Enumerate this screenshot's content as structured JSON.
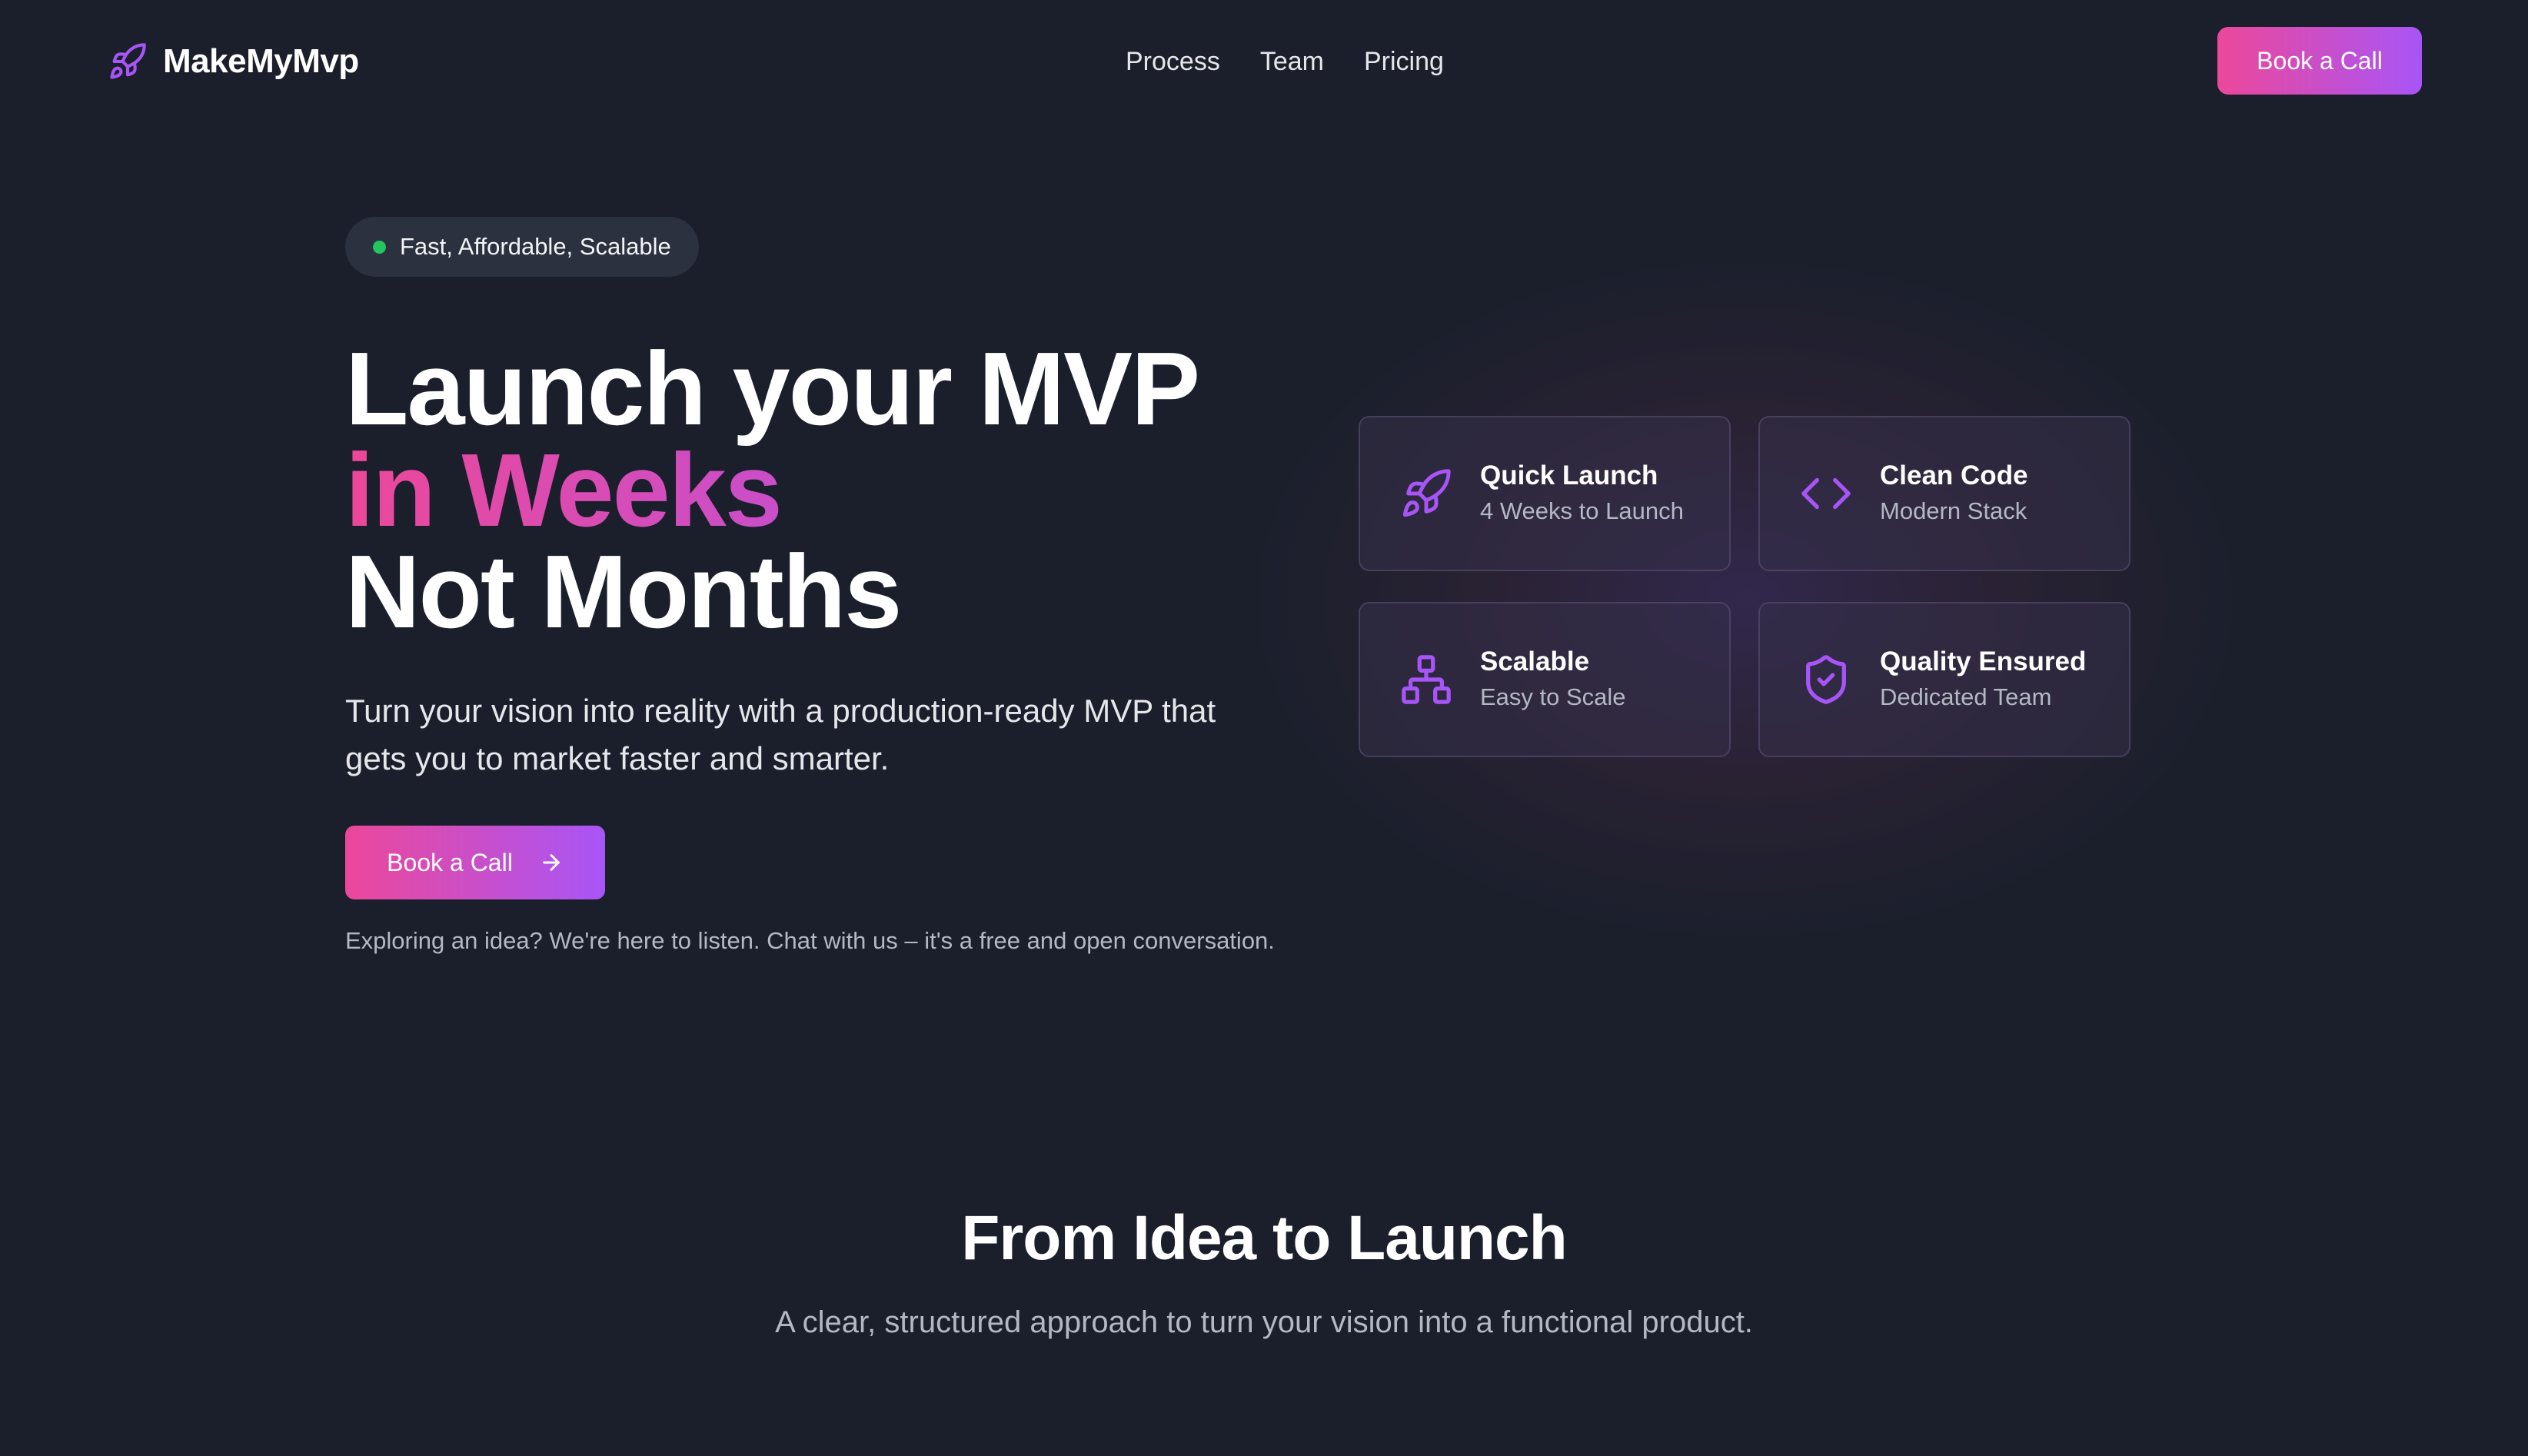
{
  "brand": {
    "name": "MakeMyMvp",
    "icon": "rocket-icon"
  },
  "nav": {
    "links": [
      "Process",
      "Team",
      "Pricing"
    ],
    "cta_label": "Book a Call"
  },
  "hero": {
    "badge": "Fast, Affordable, Scalable",
    "title_line1": "Launch your MVP",
    "title_line2": "in Weeks",
    "title_line3": "Not Months",
    "subtitle": "Turn your vision into reality with a production-ready MVP that gets you to market faster and smarter.",
    "cta_label": "Book a Call",
    "note": "Exploring an idea? We're here to listen. Chat with us – it's a free and open conversation."
  },
  "features": [
    {
      "title": "Quick Launch",
      "subtitle": "4 Weeks to Launch",
      "icon": "rocket-icon"
    },
    {
      "title": "Clean Code",
      "subtitle": "Modern Stack",
      "icon": "code-icon"
    },
    {
      "title": "Scalable",
      "subtitle": "Easy to Scale",
      "icon": "network-icon"
    },
    {
      "title": "Quality Ensured",
      "subtitle": "Dedicated Team",
      "icon": "shield-check-icon"
    }
  ],
  "section": {
    "title": "From Idea to Launch",
    "subtitle": "A clear, structured approach to turn your vision into a functional product."
  },
  "colors": {
    "background": "#1b1f2c",
    "accent_start": "#ec4899",
    "accent_end": "#a855f7",
    "badge_dot": "#22c55e",
    "icon": "#a855f7"
  }
}
